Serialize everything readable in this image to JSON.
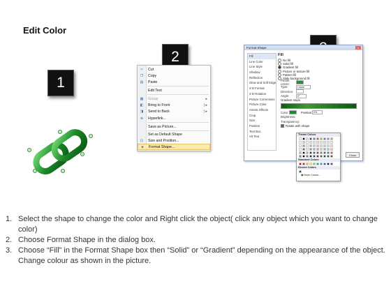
{
  "title": "Edit Color",
  "badges": [
    "1",
    "2",
    "3"
  ],
  "context_menu": {
    "items": [
      {
        "label": "Cut",
        "icon": "scissors-icon",
        "disabled": false
      },
      {
        "label": "Copy",
        "icon": "copy-icon",
        "disabled": false
      },
      {
        "label": "Paste",
        "icon": "paste-icon",
        "disabled": false
      },
      {
        "label": "Edit Text",
        "icon": "",
        "disabled": false
      },
      {
        "label": "Group",
        "icon": "group-icon",
        "disabled": true
      },
      {
        "label": "Bring to Front",
        "icon": "bring-front-icon",
        "disabled": false
      },
      {
        "label": "Send to Back",
        "icon": "send-back-icon",
        "disabled": false
      },
      {
        "label": "Hyperlink...",
        "icon": "hyperlink-icon",
        "disabled": false
      },
      {
        "label": "Save as Picture...",
        "icon": "",
        "disabled": false
      },
      {
        "label": "Set as Default Shape",
        "icon": "",
        "disabled": false
      },
      {
        "label": "Size and Position...",
        "icon": "size-position-icon",
        "disabled": false
      },
      {
        "label": "Format Shape...",
        "icon": "format-shape-icon",
        "disabled": false
      }
    ]
  },
  "format_dialog": {
    "title": "Format Shape",
    "close_glyph": "x",
    "categories": [
      "Fill",
      "Line Color",
      "Line Style",
      "Shadow",
      "Reflection",
      "Glow and Soft Edges",
      "3-D Format",
      "3-D Rotation",
      "Picture Corrections",
      "Picture Color",
      "Artistic Effects",
      "Crop",
      "Size",
      "Position",
      "Text Box",
      "Alt Text"
    ],
    "selected_category": "Fill",
    "pane_heading": "Fill",
    "fill_options": [
      "No fill",
      "Solid fill",
      "Gradient fill",
      "Picture or texture fill",
      "Pattern fill",
      "Slide background fill"
    ],
    "selected_fill": "Gradient fill",
    "fields": [
      {
        "label": "Preset colors:",
        "value": ""
      },
      {
        "label": "Type:",
        "value": "Linear"
      },
      {
        "label": "Direction:",
        "value": ""
      },
      {
        "label": "Angle:",
        "value": "0°"
      }
    ],
    "gradient_stops_label": "Gradient stops",
    "color_label": "Color",
    "position_label": "Position:",
    "position_value": "0%",
    "brightness_label": "Brightness:",
    "transparency_label": "Transparency:",
    "rotate_label": "Rotate with shape",
    "close_button": "Close"
  },
  "color_picker": {
    "theme_label": "Theme Colors",
    "standard_label": "Standard Colors",
    "recent_label": "Recent Colors",
    "more_label": "More Colors...",
    "theme_colors": [
      "#ffffff",
      "#000000",
      "#eeece1",
      "#1f497d",
      "#4f81bd",
      "#c0504d",
      "#9bbb59",
      "#8064a2",
      "#4bacc6",
      "#f79646"
    ],
    "standard_colors": [
      "#c00000",
      "#ff0000",
      "#ffc000",
      "#ffff00",
      "#92d050",
      "#00b050",
      "#00b0f0",
      "#0070c0",
      "#002060",
      "#7030a0"
    ],
    "recent_colors": [
      "#0b6b1a"
    ]
  },
  "instructions": [
    {
      "num": "1.",
      "text": "Select the shape to change the color and Right click the object( click any object which you want to change color)"
    },
    {
      "num": "2.",
      "text": "Choose Format Shape in the dialog box."
    },
    {
      "num": "3.",
      "text": "Choose “Fill” in the Format Shape box then “Solid” or “Gradient” depending on the appearance of the object. Change colour as shown in the picture."
    }
  ],
  "colors": {
    "link_green": "#1c8a2c",
    "highlight": "#fde9a8"
  }
}
